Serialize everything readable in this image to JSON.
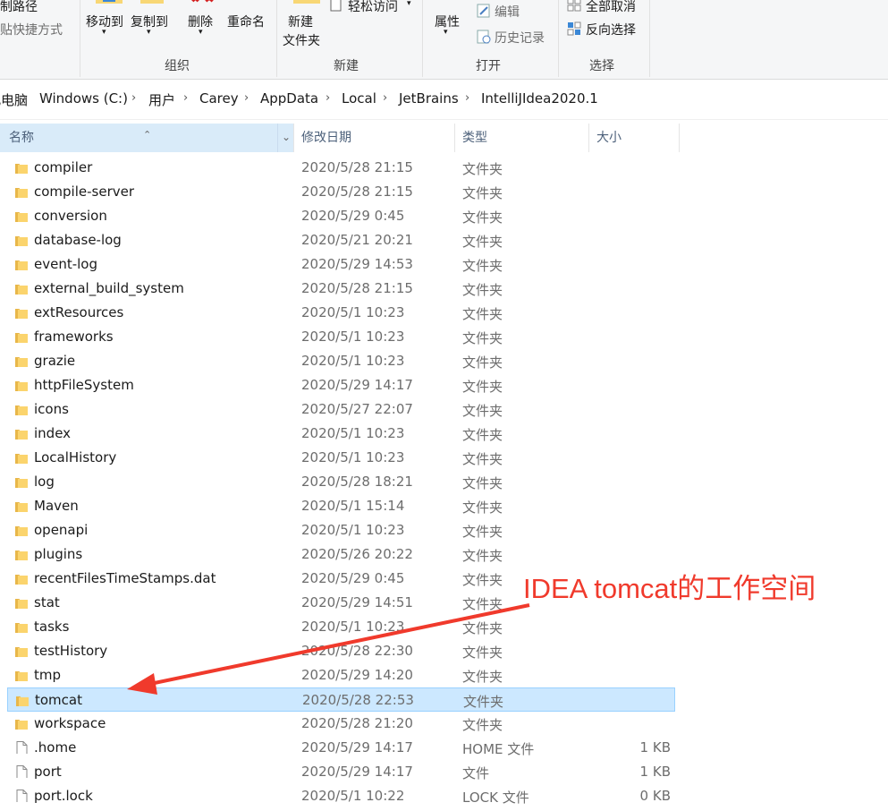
{
  "ribbon": {
    "copy_path": "复制路径",
    "paste_shortcut": "粘贴快捷方式",
    "move_to": "移动到",
    "copy_to": "复制到",
    "delete": "删除",
    "rename": "重命名",
    "new_folder_line1": "新建",
    "new_folder_line2": "文件夹",
    "easy_access": "轻松访问",
    "properties": "属性",
    "edit": "编辑",
    "history": "历史记录",
    "select_none": "全部取消",
    "invert_selection": "反向选择",
    "group_organize": "组织",
    "group_new": "新建",
    "group_open": "打开",
    "group_select": "选择"
  },
  "breadcrumb": [
    "此电脑",
    "Windows (C:)",
    "用户",
    "Carey",
    "AppData",
    "Local",
    "JetBrains",
    "IntelliJIdea2020.1"
  ],
  "columns": {
    "name": "名称",
    "date": "修改日期",
    "type": "类型",
    "size": "大小"
  },
  "files": [
    {
      "name": "compiler",
      "date": "2020/5/28 21:15",
      "type": "文件夹",
      "size": "",
      "kind": "folder"
    },
    {
      "name": "compile-server",
      "date": "2020/5/28 21:15",
      "type": "文件夹",
      "size": "",
      "kind": "folder"
    },
    {
      "name": "conversion",
      "date": "2020/5/29 0:45",
      "type": "文件夹",
      "size": "",
      "kind": "folder"
    },
    {
      "name": "database-log",
      "date": "2020/5/21 20:21",
      "type": "文件夹",
      "size": "",
      "kind": "folder"
    },
    {
      "name": "event-log",
      "date": "2020/5/29 14:53",
      "type": "文件夹",
      "size": "",
      "kind": "folder"
    },
    {
      "name": "external_build_system",
      "date": "2020/5/28 21:15",
      "type": "文件夹",
      "size": "",
      "kind": "folder"
    },
    {
      "name": "extResources",
      "date": "2020/5/1 10:23",
      "type": "文件夹",
      "size": "",
      "kind": "folder"
    },
    {
      "name": "frameworks",
      "date": "2020/5/1 10:23",
      "type": "文件夹",
      "size": "",
      "kind": "folder"
    },
    {
      "name": "grazie",
      "date": "2020/5/1 10:23",
      "type": "文件夹",
      "size": "",
      "kind": "folder"
    },
    {
      "name": "httpFileSystem",
      "date": "2020/5/29 14:17",
      "type": "文件夹",
      "size": "",
      "kind": "folder"
    },
    {
      "name": "icons",
      "date": "2020/5/27 22:07",
      "type": "文件夹",
      "size": "",
      "kind": "folder"
    },
    {
      "name": "index",
      "date": "2020/5/1 10:23",
      "type": "文件夹",
      "size": "",
      "kind": "folder"
    },
    {
      "name": "LocalHistory",
      "date": "2020/5/1 10:23",
      "type": "文件夹",
      "size": "",
      "kind": "folder"
    },
    {
      "name": "log",
      "date": "2020/5/28 18:21",
      "type": "文件夹",
      "size": "",
      "kind": "folder"
    },
    {
      "name": "Maven",
      "date": "2020/5/1 15:14",
      "type": "文件夹",
      "size": "",
      "kind": "folder"
    },
    {
      "name": "openapi",
      "date": "2020/5/1 10:23",
      "type": "文件夹",
      "size": "",
      "kind": "folder"
    },
    {
      "name": "plugins",
      "date": "2020/5/26 20:22",
      "type": "文件夹",
      "size": "",
      "kind": "folder"
    },
    {
      "name": "recentFilesTimeStamps.dat",
      "date": "2020/5/29 0:45",
      "type": "文件夹",
      "size": "",
      "kind": "folder"
    },
    {
      "name": "stat",
      "date": "2020/5/29 14:51",
      "type": "文件夹",
      "size": "",
      "kind": "folder"
    },
    {
      "name": "tasks",
      "date": "2020/5/1 10:23",
      "type": "文件夹",
      "size": "",
      "kind": "folder"
    },
    {
      "name": "testHistory",
      "date": "2020/5/28 22:30",
      "type": "文件夹",
      "size": "",
      "kind": "folder"
    },
    {
      "name": "tmp",
      "date": "2020/5/29 14:20",
      "type": "文件夹",
      "size": "",
      "kind": "folder"
    },
    {
      "name": "tomcat",
      "date": "2020/5/28 22:53",
      "type": "文件夹",
      "size": "",
      "kind": "folder",
      "selected": true
    },
    {
      "name": "workspace",
      "date": "2020/5/28 21:20",
      "type": "文件夹",
      "size": "",
      "kind": "folder"
    },
    {
      "name": ".home",
      "date": "2020/5/29 14:17",
      "type": "HOME 文件",
      "size": "1 KB",
      "kind": "file"
    },
    {
      "name": "port",
      "date": "2020/5/29 14:17",
      "type": "文件",
      "size": "1 KB",
      "kind": "file"
    },
    {
      "name": "port.lock",
      "date": "2020/5/1 10:22",
      "type": "LOCK 文件",
      "size": "0 KB",
      "kind": "file"
    }
  ],
  "annotation": "IDEA tomcat的工作空间",
  "colors": {
    "annotation": "#f03a2c",
    "selection": "#cce8ff",
    "folder": "#f8d775"
  }
}
